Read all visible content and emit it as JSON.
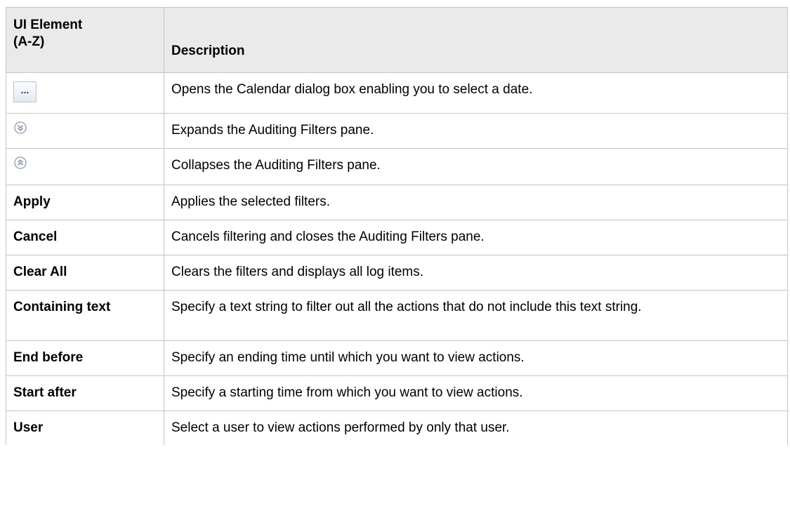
{
  "table": {
    "headers": {
      "element_line1": "UI Element",
      "element_line2": "(A-Z)",
      "description": "Description"
    },
    "rows": [
      {
        "icon": "ellipsis-button-icon",
        "icon_text": "...",
        "description": "Opens the Calendar dialog box enabling you to select a date."
      },
      {
        "icon": "expand-double-chevron-icon",
        "description": "Expands the Auditing Filters pane."
      },
      {
        "icon": "collapse-double-chevron-icon",
        "description": "Collapses the Auditing Filters pane."
      },
      {
        "element": "Apply",
        "description": "Applies the selected filters."
      },
      {
        "element": "Cancel",
        "description": "Cancels filtering and closes the Auditing Filters pane."
      },
      {
        "element": "Clear All",
        "description": "Clears the filters and displays all log items."
      },
      {
        "element": "Containing text",
        "description": "Specify a text string to filter out all the actions that do not include this text string."
      },
      {
        "element": "End before",
        "description": "Specify an ending time until which you want to view actions."
      },
      {
        "element": "Start after",
        "description": "Specify a starting time from which you want to view actions."
      },
      {
        "element": "User",
        "description": "Select a user to view actions performed by only that user."
      }
    ]
  },
  "colors": {
    "header_bg": "#eaeaea",
    "border": "#c4c4c4",
    "icon_accent": "#8a9bb2"
  }
}
